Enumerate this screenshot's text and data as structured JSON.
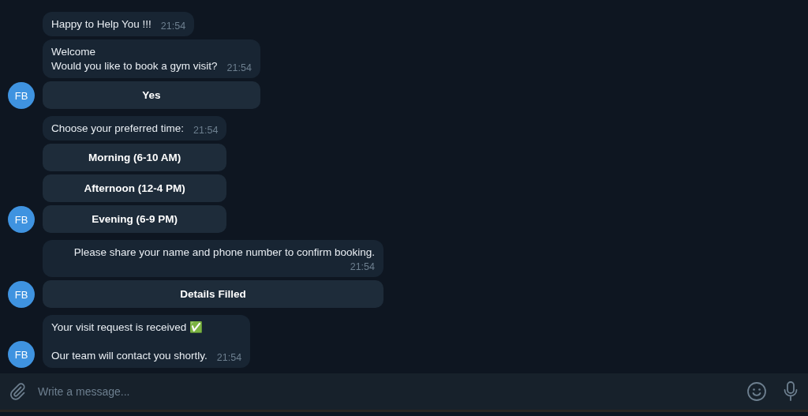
{
  "groups": [
    {
      "avatar": "FB",
      "messages": [
        {
          "text": "Happy to Help You !!!",
          "time": "21:54"
        },
        {
          "text": "Welcome\nWould you like to book a gym visit?",
          "time": "21:54"
        }
      ],
      "buttons": [
        "Yes"
      ]
    },
    {
      "avatar": "FB",
      "messages": [
        {
          "text": "Choose your preferred time:",
          "time": "21:54"
        }
      ],
      "buttons": [
        "Morning (6-10 AM)",
        "Afternoon (12-4 PM)",
        "Evening (6-9 PM)"
      ]
    },
    {
      "avatar": "FB",
      "messages": [
        {
          "text": "Please share your name and phone number to confirm booking.",
          "time": "21:54"
        }
      ],
      "buttons": [
        "Details Filled"
      ]
    },
    {
      "avatar": "FB",
      "messages": [
        {
          "text": "Your visit request is received ✅\n\nOur team will contact you shortly.",
          "time": "21:54"
        }
      ]
    }
  ],
  "composer": {
    "placeholder": "Write a message..."
  }
}
